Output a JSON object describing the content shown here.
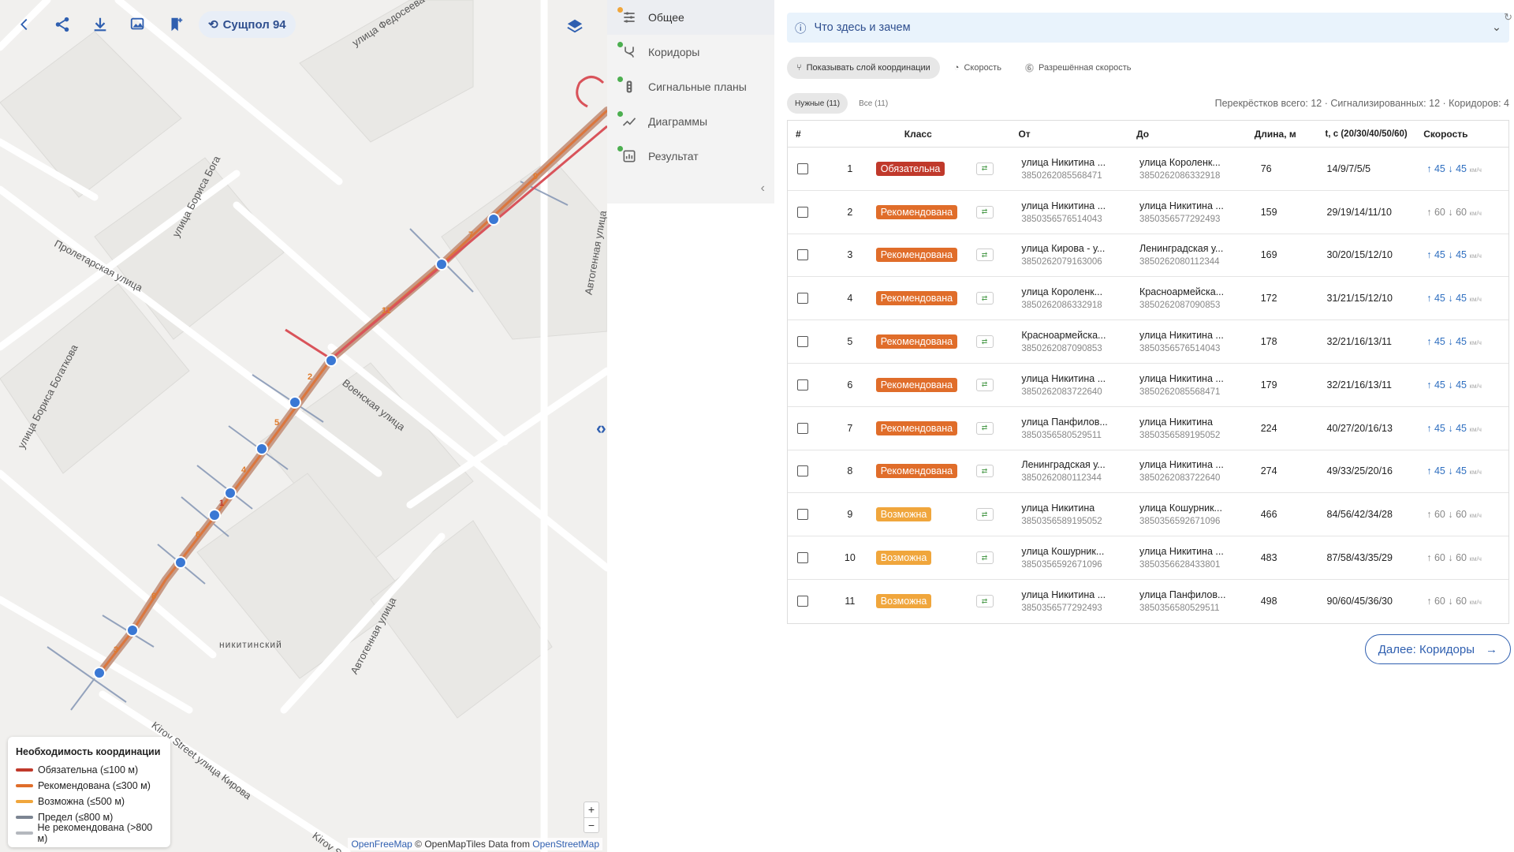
{
  "map": {
    "toolbar": {
      "suschpol_label": "Сущпол 94"
    },
    "street_labels": [
      "улица Федосеева",
      "улица Бориса Бога",
      "Пролетарская улица",
      "улица Бориса Богаткова",
      "Военская улица",
      "никитинский",
      "Автогенная улица",
      "Автогенная улица",
      "Kirov Street улица Кирова",
      "Kirov St"
    ],
    "segment_numbers": [
      "9",
      "7",
      "11",
      "2",
      "5",
      "4",
      "1",
      "6",
      "8",
      "3"
    ],
    "legend": {
      "title": "Необходимость координации",
      "items": [
        {
          "label": "Обязательна (≤100 м)",
          "color": "#c0392b"
        },
        {
          "label": "Рекомендована (≤300 м)",
          "color": "#e06d2a"
        },
        {
          "label": "Возможна (≤500 м)",
          "color": "#f0a63c"
        },
        {
          "label": "Предел (≤800 м)",
          "color": "#7c8592"
        },
        {
          "label": "Не рекомендована (>800 м)",
          "color": "#b4b8be"
        }
      ]
    },
    "zoom": {
      "in": "+",
      "out": "−"
    },
    "attribution": {
      "osm_free": "OpenFreeMap",
      "mid": "© OpenMapTiles Data from",
      "osm": "OpenStreetMap"
    }
  },
  "nav": {
    "items": [
      {
        "label": "Общее",
        "dot": "#f0a63c"
      },
      {
        "label": "Коридоры",
        "dot": "#4caf50"
      },
      {
        "label": "Сигнальные планы",
        "dot": "#4caf50"
      },
      {
        "label": "Диаграммы",
        "dot": "#4caf50"
      },
      {
        "label": "Результат",
        "dot": "#4caf50"
      }
    ]
  },
  "main": {
    "info_title": "Что здесь и зачем",
    "chips": [
      "Показывать слой координации",
      "Скорость",
      "Разрешённая скорость"
    ],
    "tabs": [
      "Нужные (11)",
      "Все (11)"
    ],
    "stats": "Перекрёстков всего: 12 · Сигнализированных: 12 · Коридоров: 4",
    "columns": [
      "#",
      "Класс",
      "От",
      "До",
      "Длина, м",
      "t, с (20/30/40/50/60)",
      "Скорость"
    ],
    "rows": [
      {
        "n": "1",
        "cls": "Обязательна",
        "from": "улица Никитина ...",
        "from_id": "3850262085568471",
        "to": "улица Короленк...",
        "to_id": "3850262086332918",
        "len": "76",
        "t": "14/9/7/5/5",
        "s1": "45",
        "s2": "45",
        "hl": true
      },
      {
        "n": "2",
        "cls": "Рекомендована",
        "from": "улица Никитина ...",
        "from_id": "3850356576514043",
        "to": "улица Никитина ...",
        "to_id": "3850356577292493",
        "len": "159",
        "t": "29/19/14/11/10",
        "s1": "60",
        "s2": "60",
        "hl": false
      },
      {
        "n": "3",
        "cls": "Рекомендована",
        "from": "улица Кирова - у...",
        "from_id": "3850262079163006",
        "to": "Ленинградская у...",
        "to_id": "3850262080112344",
        "len": "169",
        "t": "30/20/15/12/10",
        "s1": "45",
        "s2": "45",
        "hl": true
      },
      {
        "n": "4",
        "cls": "Рекомендована",
        "from": "улица Короленк...",
        "from_id": "3850262086332918",
        "to": "Красноармейска...",
        "to_id": "3850262087090853",
        "len": "172",
        "t": "31/21/15/12/10",
        "s1": "45",
        "s2": "45",
        "hl": true
      },
      {
        "n": "5",
        "cls": "Рекомендована",
        "from": "Красноармейска...",
        "from_id": "3850262087090853",
        "to": "улица Никитина ...",
        "to_id": "3850356576514043",
        "len": "178",
        "t": "32/21/16/13/11",
        "s1": "45",
        "s2": "45",
        "hl": true
      },
      {
        "n": "6",
        "cls": "Рекомендована",
        "from": "улица Никитина ...",
        "from_id": "3850262083722640",
        "to": "улица Никитина ...",
        "to_id": "3850262085568471",
        "len": "179",
        "t": "32/21/16/13/11",
        "s1": "45",
        "s2": "45",
        "hl": true
      },
      {
        "n": "7",
        "cls": "Рекомендована",
        "from": "улица Панфилов...",
        "from_id": "3850356580529511",
        "to": "улица Никитина",
        "to_id": "3850356589195052",
        "len": "224",
        "t": "40/27/20/16/13",
        "s1": "45",
        "s2": "45",
        "hl": true
      },
      {
        "n": "8",
        "cls": "Рекомендована",
        "from": "Ленинградская у...",
        "from_id": "3850262080112344",
        "to": "улица Никитина ...",
        "to_id": "3850262083722640",
        "len": "274",
        "t": "49/33/25/20/16",
        "s1": "45",
        "s2": "45",
        "hl": true
      },
      {
        "n": "9",
        "cls": "Возможна",
        "from": "улица Никитина",
        "from_id": "3850356589195052",
        "to": "улица Кошурник...",
        "to_id": "3850356592671096",
        "len": "466",
        "t": "84/56/42/34/28",
        "s1": "60",
        "s2": "60",
        "hl": false
      },
      {
        "n": "10",
        "cls": "Возможна",
        "from": "улица Кошурник...",
        "from_id": "3850356592671096",
        "to": "улица Никитина ...",
        "to_id": "3850356628433801",
        "len": "483",
        "t": "87/58/43/35/29",
        "s1": "60",
        "s2": "60",
        "hl": false
      },
      {
        "n": "11",
        "cls": "Возможна",
        "from": "улица Никитина ...",
        "from_id": "3850356577292493",
        "to": "улица Панфилов...",
        "to_id": "3850356580529511",
        "len": "498",
        "t": "90/60/45/36/30",
        "s1": "60",
        "s2": "60",
        "hl": false
      }
    ],
    "speed_unit": "км/ч",
    "next_button": "Далее: Коридоры",
    "class_colors": {
      "Обязательна": "#c0392b",
      "Рекомендована": "#e06d2a",
      "Возможна": "#f0a63c"
    }
  }
}
